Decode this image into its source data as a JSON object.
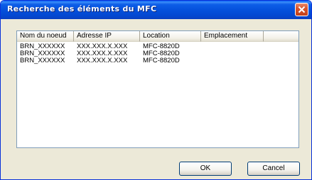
{
  "window": {
    "title": "Recherche des éléments du MFC"
  },
  "list": {
    "columns": [
      "Nom du noeud",
      "Adresse IP",
      "Location",
      "Emplacement",
      ""
    ],
    "rows": [
      {
        "node": "BRN_XXXXXX",
        "ip": "XXX.XXX.X.XXX",
        "location": "MFC-8820D",
        "emplacement": ""
      },
      {
        "node": "BRN_XXXXXX",
        "ip": "XXX.XXX.X.XXX",
        "location": "MFC-8820D",
        "emplacement": ""
      },
      {
        "node": "BRN_XXXXXX",
        "ip": "XXX.XXX.X.XXX",
        "location": "MFC-8820D",
        "emplacement": ""
      }
    ]
  },
  "buttons": {
    "ok": "OK",
    "cancel": "Cancel"
  },
  "icons": {
    "close": "close-icon"
  }
}
